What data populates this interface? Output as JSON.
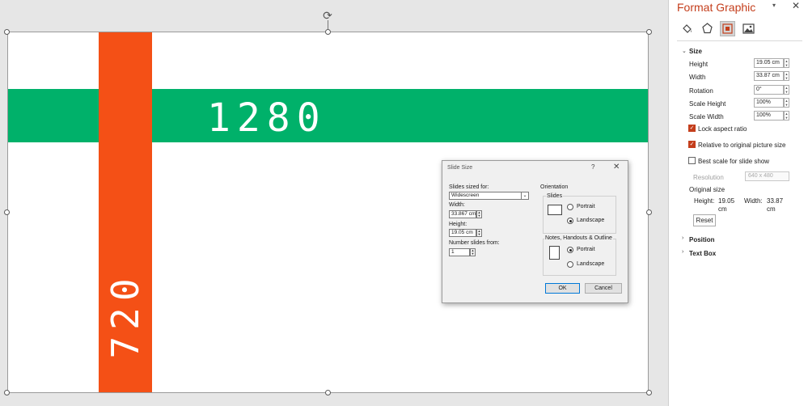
{
  "slide": {
    "label_top": "1280",
    "label_side": "720",
    "colors": {
      "green_band": "#00b16a",
      "orange_band": "#f45016"
    }
  },
  "dialog": {
    "title": "Slide Size",
    "help": "?",
    "close": "✕",
    "sized_for_label": "Slides sized for:",
    "sized_for_value": "Widescreen",
    "width_label": "Width:",
    "width_value": "33.867 cm",
    "height_label": "Height:",
    "height_value": "19.05 cm",
    "number_from_label": "Number slides from:",
    "number_from_value": "1",
    "orientation_label": "Orientation",
    "slides_group_label": "Slides",
    "slides_portrait": "Portrait",
    "slides_landscape": "Landscape",
    "notes_group_label": "Notes, Handouts & Outline",
    "notes_portrait": "Portrait",
    "notes_landscape": "Landscape",
    "ok": "OK",
    "cancel": "Cancel"
  },
  "pane": {
    "title": "Format Graphic",
    "dropdown_icon": "▾",
    "close_icon": "✕",
    "tabs": [
      "fill-line",
      "effects",
      "size-properties",
      "picture"
    ],
    "size_section": "Size",
    "height_label": "Height",
    "height_value": "19.05 cm",
    "width_label": "Width",
    "width_value": "33.87 cm",
    "rotation_label": "Rotation",
    "rotation_value": "0°",
    "scale_height_label": "Scale Height",
    "scale_height_value": "100%",
    "scale_width_label": "Scale Width",
    "scale_width_value": "100%",
    "lock_aspect": "Lock aspect ratio",
    "relative_original": "Relative to original picture size",
    "best_scale": "Best scale for slide show",
    "resolution_label": "Resolution",
    "resolution_value": "640 x 480",
    "original_size_label": "Original size",
    "orig_height_label": "Height:",
    "orig_height_value": "19.05",
    "orig_height_unit": "cm",
    "orig_width_label": "Width:",
    "orig_width_value": "33.87",
    "orig_width_unit": "cm",
    "reset": "Reset",
    "position_section": "Position",
    "textbox_section": "Text Box",
    "accent_color": "#c43e1c"
  }
}
